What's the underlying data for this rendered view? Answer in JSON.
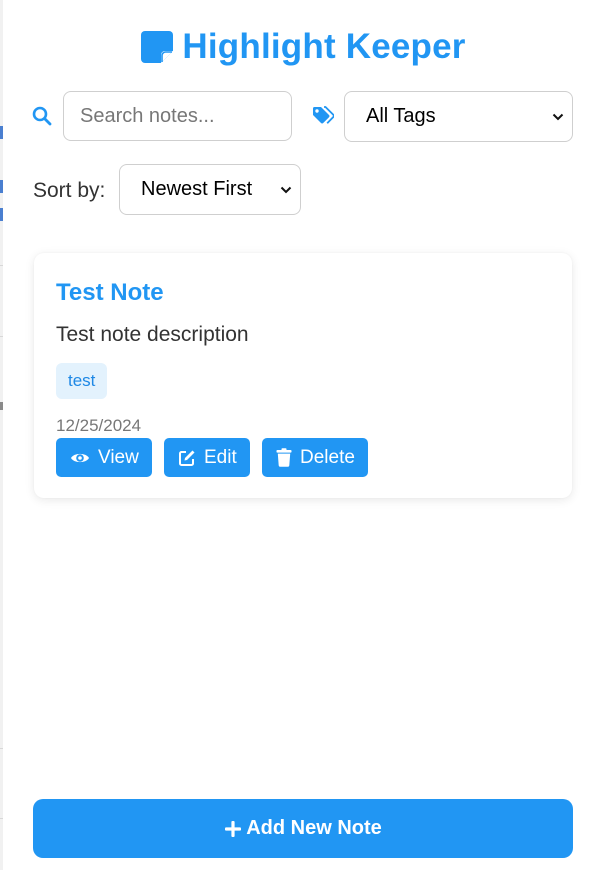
{
  "app": {
    "title": "Highlight Keeper",
    "logo_icon": "sticky-note-icon",
    "accent_color": "#2196f3"
  },
  "filters": {
    "search_icon": "search-icon",
    "search_placeholder": "Search notes...",
    "search_value": "",
    "tag_icon": "tags-icon",
    "tag_selected": "All Tags",
    "sort_label": "Sort by:",
    "sort_selected": "Newest First"
  },
  "notes": [
    {
      "title": "Test Note",
      "description": "Test note description",
      "tags": [
        "test"
      ],
      "date": "12/25/2024",
      "actions": {
        "view": "View",
        "edit": "Edit",
        "delete": "Delete"
      }
    }
  ],
  "footer": {
    "add_label": "Add New Note"
  }
}
